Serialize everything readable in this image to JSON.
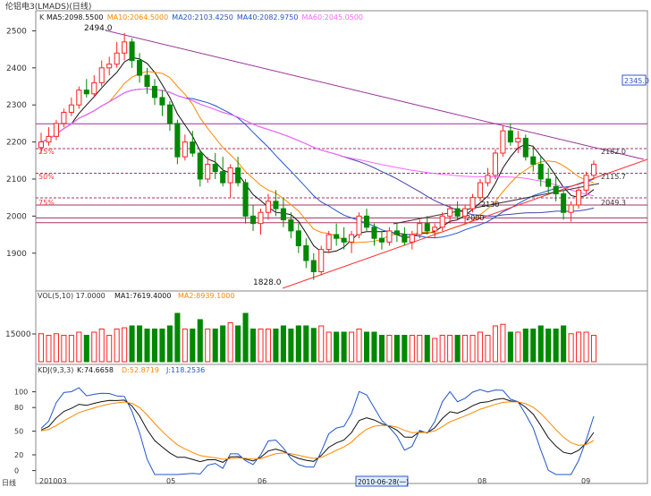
{
  "title": "伦铝电3(LMADS)(日线)",
  "header_mode": "K",
  "ma_legend": [
    {
      "label": "MA5:2098.5500",
      "color": "#111111"
    },
    {
      "label": "MA10:2064.5000",
      "color": "#ff8800"
    },
    {
      "label": "MA20:2103.4250",
      "color": "#2255cc"
    },
    {
      "label": "MA40:2082.9750",
      "color": "#2255cc"
    },
    {
      "label": "MA60:2045.0500",
      "color": "#ff66ff"
    }
  ],
  "vol_legend": "VOL(5,10) 17.0000",
  "vol_ma_legend": [
    {
      "label": "MA1:7619.4000",
      "color": "#111111"
    },
    {
      "label": "MA2:8939.1000",
      "color": "#ff8800"
    }
  ],
  "kdj_legend": "KDJ(9,3,3)",
  "kdj_values": [
    {
      "label": "K:74.6658",
      "color": "#111111"
    },
    {
      "label": "D:52.8719",
      "color": "#ff8800"
    },
    {
      "label": "J:118.2536",
      "color": "#2255cc"
    }
  ],
  "price_axis_ticks": [
    "2500",
    "2400",
    "2300",
    "2200",
    "2100",
    "2000",
    "1900"
  ],
  "vol_axis_ticks": [
    "15000"
  ],
  "kdj_axis_ticks": [
    "100",
    "80",
    "50",
    "20",
    "0"
  ],
  "x_axis_labels": [
    "日线",
    "201003",
    "05",
    "06",
    "2010-06-28(一)",
    "08",
    "09"
  ],
  "annotations": {
    "high": "2494.0",
    "low": "1828.0",
    "pct25": "25%",
    "pct50": "50%",
    "pct75": "75%",
    "level_2182": "2182.0",
    "level_2115": "2115.7",
    "level_2049": "2049.3",
    "level_2345": "2345.0",
    "label_2130": "2130",
    "label_2000": "2000"
  },
  "colors": {
    "up": "#ff2222",
    "down": "#008800",
    "axis": "#333333",
    "grid": "#dddddd"
  },
  "chart_data": {
    "type": "candlestick",
    "price_range": [
      1810,
      2530
    ],
    "candles": [
      [
        2185,
        2225,
        2170,
        2200
      ],
      [
        2200,
        2240,
        2190,
        2215
      ],
      [
        2215,
        2260,
        2205,
        2250
      ],
      [
        2250,
        2290,
        2240,
        2280
      ],
      [
        2280,
        2320,
        2270,
        2300
      ],
      [
        2300,
        2350,
        2290,
        2340
      ],
      [
        2340,
        2370,
        2320,
        2330
      ],
      [
        2330,
        2380,
        2320,
        2360
      ],
      [
        2360,
        2420,
        2350,
        2400
      ],
      [
        2400,
        2430,
        2380,
        2410
      ],
      [
        2410,
        2470,
        2400,
        2440
      ],
      [
        2440,
        2494,
        2420,
        2470
      ],
      [
        2470,
        2480,
        2400,
        2420
      ],
      [
        2420,
        2440,
        2360,
        2380
      ],
      [
        2380,
        2400,
        2330,
        2350
      ],
      [
        2350,
        2370,
        2300,
        2320
      ],
      [
        2320,
        2340,
        2270,
        2300
      ],
      [
        2300,
        2310,
        2230,
        2250
      ],
      [
        2250,
        2260,
        2140,
        2160
      ],
      [
        2160,
        2220,
        2150,
        2200
      ],
      [
        2200,
        2230,
        2160,
        2170
      ],
      [
        2170,
        2180,
        2080,
        2100
      ],
      [
        2100,
        2160,
        2090,
        2140
      ],
      [
        2140,
        2170,
        2100,
        2120
      ],
      [
        2120,
        2160,
        2080,
        2090
      ],
      [
        2090,
        2140,
        2050,
        2130
      ],
      [
        2130,
        2160,
        2080,
        2090
      ],
      [
        2090,
        2100,
        1980,
        2000
      ],
      [
        2000,
        2030,
        1960,
        1980
      ],
      [
        1980,
        2020,
        1950,
        2010
      ],
      [
        2010,
        2060,
        1990,
        2040
      ],
      [
        2040,
        2070,
        2000,
        2020
      ],
      [
        2020,
        2050,
        1970,
        1990
      ],
      [
        1990,
        2010,
        1940,
        1960
      ],
      [
        1960,
        1980,
        1900,
        1920
      ],
      [
        1920,
        1940,
        1860,
        1880
      ],
      [
        1880,
        1900,
        1828,
        1850
      ],
      [
        1850,
        1920,
        1840,
        1910
      ],
      [
        1910,
        1960,
        1900,
        1950
      ],
      [
        1950,
        1980,
        1920,
        1940
      ],
      [
        1940,
        1970,
        1910,
        1930
      ],
      [
        1930,
        1960,
        1900,
        1950
      ],
      [
        1950,
        2010,
        1940,
        2000
      ],
      [
        2000,
        2020,
        1960,
        1970
      ],
      [
        1970,
        1980,
        1920,
        1940
      ],
      [
        1940,
        1960,
        1910,
        1930
      ],
      [
        1930,
        1970,
        1920,
        1960
      ],
      [
        1960,
        1980,
        1930,
        1950
      ],
      [
        1950,
        1970,
        1920,
        1930
      ],
      [
        1930,
        1960,
        1910,
        1950
      ],
      [
        1950,
        1990,
        1940,
        1980
      ],
      [
        1980,
        2000,
        1950,
        1960
      ],
      [
        1960,
        1980,
        1940,
        1970
      ],
      [
        1970,
        2010,
        1960,
        2000
      ],
      [
        2000,
        2030,
        1980,
        2020
      ],
      [
        2020,
        2040,
        1990,
        2000
      ],
      [
        2000,
        2030,
        1980,
        2020
      ],
      [
        2020,
        2060,
        2010,
        2050
      ],
      [
        2050,
        2100,
        2040,
        2090
      ],
      [
        2090,
        2130,
        2080,
        2110
      ],
      [
        2110,
        2180,
        2100,
        2170
      ],
      [
        2170,
        2245,
        2160,
        2230
      ],
      [
        2230,
        2250,
        2190,
        2200
      ],
      [
        2200,
        2230,
        2170,
        2210
      ],
      [
        2210,
        2220,
        2150,
        2160
      ],
      [
        2160,
        2190,
        2120,
        2140
      ],
      [
        2140,
        2160,
        2080,
        2100
      ],
      [
        2100,
        2130,
        2060,
        2080
      ],
      [
        2080,
        2110,
        2040,
        2060
      ],
      [
        2060,
        2070,
        1990,
        2010
      ],
      [
        2010,
        2040,
        1985,
        2030
      ],
      [
        2030,
        2080,
        2020,
        2070
      ],
      [
        2070,
        2120,
        2060,
        2110
      ],
      [
        2110,
        2150,
        2100,
        2140
      ]
    ],
    "volume_y": [
      15000
    ],
    "kdj_range": [
      -5,
      120
    ]
  }
}
